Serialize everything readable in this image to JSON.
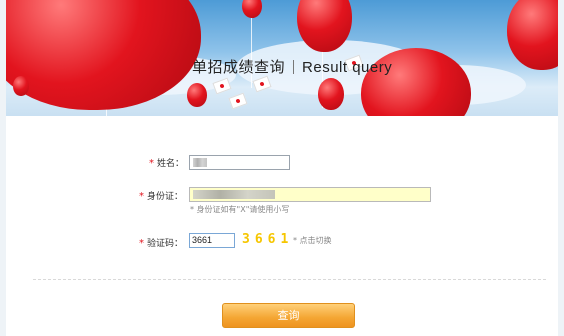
{
  "banner": {
    "title_cn": "单招成绩查询",
    "title_en": "Result query"
  },
  "form": {
    "name": {
      "label": "姓名：",
      "value": ""
    },
    "id_card": {
      "label": "身份证：",
      "value": "",
      "hint": "* 身份证如有\"X\"请使用小写"
    },
    "captcha": {
      "label": "验证码：",
      "value": "3661",
      "image_text": "3661",
      "switch_text": "* 点击切换"
    }
  },
  "actions": {
    "submit_label": "查询"
  },
  "colors": {
    "accent": "#e2141e",
    "button": "#f4a633",
    "captcha": "#f6c600"
  }
}
